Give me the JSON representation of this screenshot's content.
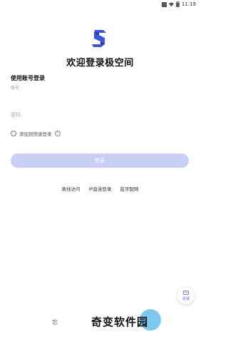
{
  "status_bar": {
    "left_text": "",
    "time": "11:19",
    "icons": [
      "signal-icon",
      "wifi-icon",
      "battery-icon"
    ]
  },
  "app": {
    "title": "欢迎登录极空间",
    "logo": "jikongjian-logo-icon"
  },
  "login_form": {
    "section_heading": "使用账号登录",
    "account_label": "账号",
    "password_placeholder": "密码",
    "remember_label": "添加到快速登录",
    "help_icon": "?",
    "login_button": "登录"
  },
  "links": {
    "offline": "离线访问",
    "ip_direct": "IP直连登录",
    "bluetooth": "蓝牙配网"
  },
  "feedback": {
    "label": "反馈",
    "icon": "feedback-icon"
  },
  "watermark": {
    "text": "奇变软件园",
    "partial_left_char": "忘"
  },
  "colors": {
    "accent": "#4b5bd6",
    "button_bg": "#c9cef6",
    "watermark_circle": "#7ec7ef"
  }
}
